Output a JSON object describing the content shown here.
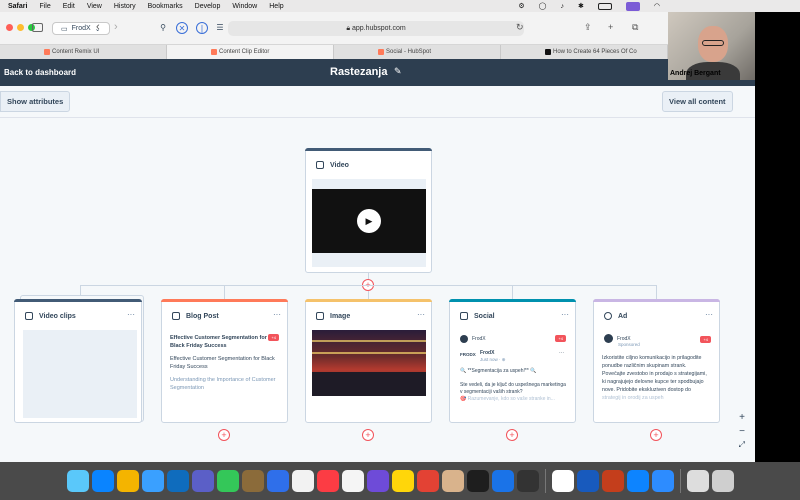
{
  "menubar": {
    "app": "Safari",
    "items": [
      "File",
      "Edit",
      "View",
      "History",
      "Bookmarks",
      "Develop",
      "Window",
      "Help"
    ]
  },
  "browser": {
    "tab_group": "FrodX",
    "url": "app.hubspot.com",
    "tabs": [
      {
        "label": "Content Remix UI",
        "active": false
      },
      {
        "label": "Content Clip Editor",
        "active": true
      },
      {
        "label": "Social - HubSpot",
        "active": false
      },
      {
        "label": "How to Create 64 Pieces Of Co",
        "active": false
      }
    ]
  },
  "header": {
    "back_label": "Back to dashboard",
    "title": "Rastezanja"
  },
  "actions": {
    "show_attributes": "Show attributes",
    "view_all": "View all content"
  },
  "source_card": {
    "label": "Video"
  },
  "cards": {
    "video_clips": {
      "label": "Video clips",
      "dots": "···"
    },
    "blog": {
      "label": "Blog Post",
      "dots": "···",
      "tag": "+4",
      "title": "Effective Customer Segmentation for Black Friday Success",
      "line1": "Effective Customer Segmentation for Black Friday Success",
      "line2": "Understanding the Importance of Customer Segmentation"
    },
    "image": {
      "label": "Image",
      "dots": "···"
    },
    "social": {
      "label": "Social",
      "dots": "···",
      "account": "FrodX",
      "tag": "+4",
      "brand": "FRODX",
      "author": "FrodX",
      "time": "Just now · ⊕",
      "headline": "🔍 **Segmentacija za uspeh!** 🔍",
      "body": "Ste vedeli, da je ključ do uspešnega marketinga v segmentaciji vaših strank?",
      "body_fade": "🎯 Razumevanje, kdo so vaše stranke in..."
    },
    "ad": {
      "label": "Ad",
      "dots": "···",
      "account": "FrodX",
      "sponsored": "Sponsored",
      "tag": "+4",
      "body": "Izkoristite ciljno komunikacijo in prilagodite ponudbe različnim skupinam strank. Povečajte zvestobo in prodajo s strategijami, ki nagrajujejo delovne kupce ter spodbujajo nove. Pridobite ekskluziven dostop do",
      "body_fade": "strategij in orodij za uspeh"
    }
  },
  "zoom": {
    "plus": "+",
    "minus": "−",
    "fit": "⤢"
  },
  "webcam": {
    "name": "Andrej Bergant"
  },
  "colors": {
    "header_bg": "#2d3e50",
    "accent": "#f2545b",
    "video_bar": "#425b76",
    "blog_bar": "#ff7a59",
    "image_bar": "#f5c26b",
    "social_bar": "#0091ae",
    "ad_bar": "#c9b6e4"
  }
}
